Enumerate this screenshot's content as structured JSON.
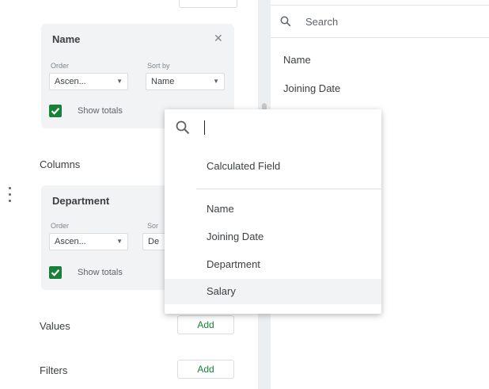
{
  "rows_section": {
    "card": {
      "title": "Name",
      "order_label": "Order",
      "order_value": "Ascen...",
      "sortby_label": "Sort by",
      "sortby_value": "Name",
      "show_totals": "Show totals",
      "checked": true
    }
  },
  "columns_section": {
    "label": "Columns",
    "card": {
      "title": "Department",
      "order_label": "Order",
      "order_value": "Ascen...",
      "sortby_label": "Sor",
      "sortby_value": "De",
      "show_totals": "Show totals",
      "checked": true
    }
  },
  "values_section": {
    "label": "Values",
    "add_label": "Add"
  },
  "filters_section": {
    "label": "Filters",
    "add_label": "Add"
  },
  "right_panel": {
    "search_placeholder": "Search",
    "fields": [
      "Name",
      "Joining Date"
    ]
  },
  "popup": {
    "calculated_field": "Calculated Field",
    "items": [
      "Name",
      "Joining Date",
      "Department",
      "Salary"
    ],
    "highlighted": "Salary"
  },
  "colors": {
    "accent_green": "#188038",
    "card_bg": "#f1f3f4",
    "divider": "#eceff1"
  },
  "icons": {
    "search": "search-icon",
    "close": "close-icon",
    "dropdown": "chevron-down-icon",
    "drag": "drag-handle-icon"
  }
}
